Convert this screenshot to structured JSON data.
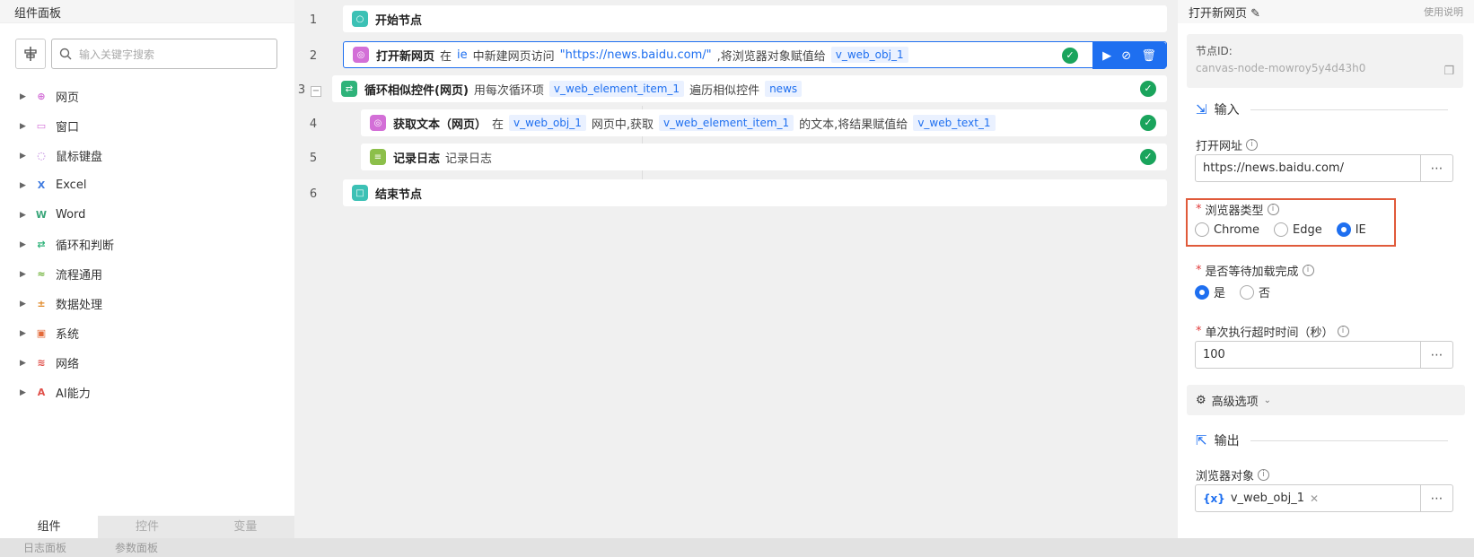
{
  "left_panel": {
    "title": "组件面板",
    "search_placeholder": "输入关键字搜索",
    "categories": [
      {
        "label": "网页",
        "color": "#d36fd7",
        "icon": "globe-icon"
      },
      {
        "label": "窗口",
        "color": "#d36fd7",
        "icon": "window-icon"
      },
      {
        "label": "鼠标键盘",
        "color": "#b069d8",
        "icon": "mouse-icon"
      },
      {
        "label": "Excel",
        "color": "#3f7be0",
        "icon": "excel-icon"
      },
      {
        "label": "Word",
        "color": "#3aa67a",
        "icon": "word-icon"
      },
      {
        "label": "循环和判断",
        "color": "#2fb37a",
        "icon": "loop-icon"
      },
      {
        "label": "流程通用",
        "color": "#6fb23a",
        "icon": "flow-icon"
      },
      {
        "label": "数据处理",
        "color": "#e08a2a",
        "icon": "data-icon"
      },
      {
        "label": "系统",
        "color": "#e36a3a",
        "icon": "system-icon"
      },
      {
        "label": "网络",
        "color": "#e0504a",
        "icon": "wifi-icon"
      },
      {
        "label": "AI能力",
        "color": "#e0504a",
        "icon": "ai-icon"
      }
    ],
    "tabs": [
      "组件",
      "控件",
      "变量"
    ]
  },
  "footer": {
    "tabs": [
      "日志面板",
      "参数面板"
    ]
  },
  "workflow": {
    "rows": [
      {
        "num": "1",
        "title": "开始节点"
      },
      {
        "num": "2",
        "title": "打开新网页",
        "parts": [
          "在",
          "ie",
          "中新建网页访问",
          "\"https://news.baidu.com/\"",
          ",将浏览器对象赋值给",
          "v_web_obj_1"
        ]
      },
      {
        "num": "3",
        "title": "循环相似控件(网页)",
        "parts": [
          "用每次循环项",
          "v_web_element_item_1",
          "遍历相似控件",
          "news"
        ]
      },
      {
        "num": "4",
        "title": "获取文本（网页）",
        "parts": [
          "在",
          "v_web_obj_1",
          "网页中,获取",
          "v_web_element_item_1",
          "的文本,将结果赋值给",
          "v_web_text_1"
        ]
      },
      {
        "num": "5",
        "title": "记录日志",
        "parts": [
          "记录日志"
        ]
      },
      {
        "num": "6",
        "title": "结束节点"
      }
    ]
  },
  "right_panel": {
    "title": "打开新网页",
    "help": "使用说明",
    "node_id_label": "节点ID:",
    "node_id_value": "canvas-node-mowroy5y4d43h0",
    "input_section": "输入",
    "url_label": "打开网址",
    "url_value": "https://news.baidu.com/",
    "browser_label": "浏览器类型",
    "browser_options": [
      "Chrome",
      "Edge",
      "IE"
    ],
    "browser_selected": "IE",
    "wait_label": "是否等待加载完成",
    "wait_options": [
      "是",
      "否"
    ],
    "timeout_label": "单次执行超时时间（秒）",
    "timeout_value": "100",
    "advanced": "高级选项",
    "output_section": "输出",
    "browser_obj_label": "浏览器对象",
    "browser_obj_value": "v_web_obj_1",
    "fx_symbol": "{x}"
  }
}
